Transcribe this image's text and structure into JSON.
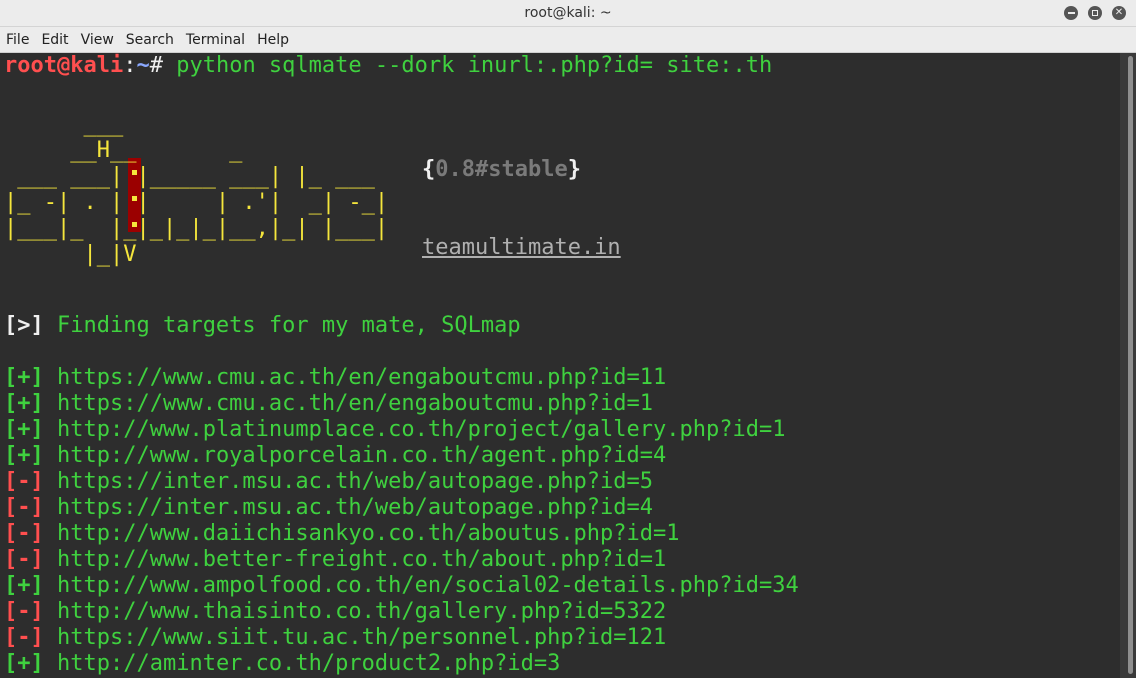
{
  "window": {
    "title": "root@kali: ~"
  },
  "menu": [
    "File",
    "Edit",
    "View",
    "Search",
    "Terminal",
    "Help"
  ],
  "prompt": {
    "user_host": "root@kali",
    "colon": ":",
    "path": "~",
    "symbol": "#",
    "command": " python sqlmate --dork inurl:.php?id= site:.th"
  },
  "banner": {
    "ascii_art": "      ___\n     __H__       _\n ___ ___| |_____ ___| |_ ___\n|_ -| . | |     | .'|  _| -_|\n|___|_  |_|_|_|_|__,|_| |___|\n      |_|V",
    "version_open": "{",
    "version": "0.8#stable",
    "version_close": "}",
    "website": "teamultimate.in"
  },
  "status_line": {
    "marker": "[>]",
    "text": " Finding targets for my mate, SQLmap"
  },
  "results": [
    {
      "marker": "[+]",
      "status": "found",
      "url": "https://www.cmu.ac.th/en/engaboutcmu.php?id=11"
    },
    {
      "marker": "[+]",
      "status": "found",
      "url": "https://www.cmu.ac.th/en/engaboutcmu.php?id=1"
    },
    {
      "marker": "[+]",
      "status": "found",
      "url": "http://www.platinumplace.co.th/project/gallery.php?id=1"
    },
    {
      "marker": "[+]",
      "status": "found",
      "url": "http://www.royalporcelain.co.th/agent.php?id=4"
    },
    {
      "marker": "[-]",
      "status": "failed",
      "url": "https://inter.msu.ac.th/web/autopage.php?id=5"
    },
    {
      "marker": "[-]",
      "status": "failed",
      "url": "https://inter.msu.ac.th/web/autopage.php?id=4"
    },
    {
      "marker": "[-]",
      "status": "failed",
      "url": "http://www.daiichisankyo.co.th/aboutus.php?id=1"
    },
    {
      "marker": "[-]",
      "status": "failed",
      "url": "http://www.better-freight.co.th/about.php?id=1"
    },
    {
      "marker": "[+]",
      "status": "found",
      "url": "http://www.ampolfood.co.th/en/social02-details.php?id=34"
    },
    {
      "marker": "[-]",
      "status": "failed",
      "url": "http://www.thaisinto.co.th/gallery.php?id=5322"
    },
    {
      "marker": "[-]",
      "status": "failed",
      "url": "https://www.siit.tu.ac.th/personnel.php?id=121"
    },
    {
      "marker": "[+]",
      "status": "found",
      "url": "http://aminter.co.th/product2.php?id=3"
    }
  ],
  "colors": {
    "found": "#3fd13f",
    "failed": "#ff4f4f",
    "logo": "#f5e63c",
    "prompt_user": "#ff4f4f",
    "prompt_path": "#8aa8ff",
    "background": "#2d2d2d"
  }
}
